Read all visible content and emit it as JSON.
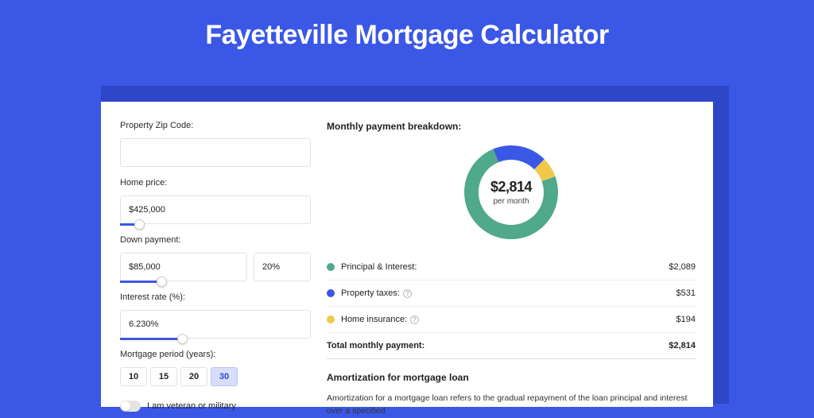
{
  "title": "Fayetteville Mortgage Calculator",
  "form": {
    "zip": {
      "label": "Property Zip Code:",
      "value": ""
    },
    "home_price": {
      "label": "Home price:",
      "value": "$425,000"
    },
    "down_payment": {
      "label": "Down payment:",
      "amount": "$85,000",
      "percent": "20%"
    },
    "interest_rate": {
      "label": "Interest rate (%):",
      "value": "6.230%"
    },
    "period": {
      "label": "Mortgage period (years):",
      "options": [
        "10",
        "15",
        "20",
        "30"
      ],
      "selected": "30"
    },
    "veteran": {
      "label": "I am veteran or military",
      "on": false
    }
  },
  "breakdown": {
    "heading": "Monthly payment breakdown:",
    "total_amount": "$2,814",
    "total_sub": "per month",
    "items": [
      {
        "label": "Principal & Interest:",
        "value": "$2,089",
        "color": "green",
        "help": false
      },
      {
        "label": "Property taxes:",
        "value": "$531",
        "color": "blue",
        "help": true
      },
      {
        "label": "Home insurance:",
        "value": "$194",
        "color": "yellow",
        "help": true
      }
    ],
    "total_row": {
      "label": "Total monthly payment:",
      "value": "$2,814"
    }
  },
  "amortization": {
    "heading": "Amortization for mortgage loan",
    "text": "Amortization for a mortgage loan refers to the gradual repayment of the loan principal and interest over a specified"
  },
  "chart_data": {
    "type": "pie",
    "title": "Monthly payment breakdown",
    "series": [
      {
        "name": "Principal & Interest",
        "value": 2089,
        "color": "#4fa98a"
      },
      {
        "name": "Property taxes",
        "value": 531,
        "color": "#3b57e6"
      },
      {
        "name": "Home insurance",
        "value": 194,
        "color": "#f0c94b"
      }
    ],
    "center_label": "$2,814",
    "center_sub": "per month"
  }
}
